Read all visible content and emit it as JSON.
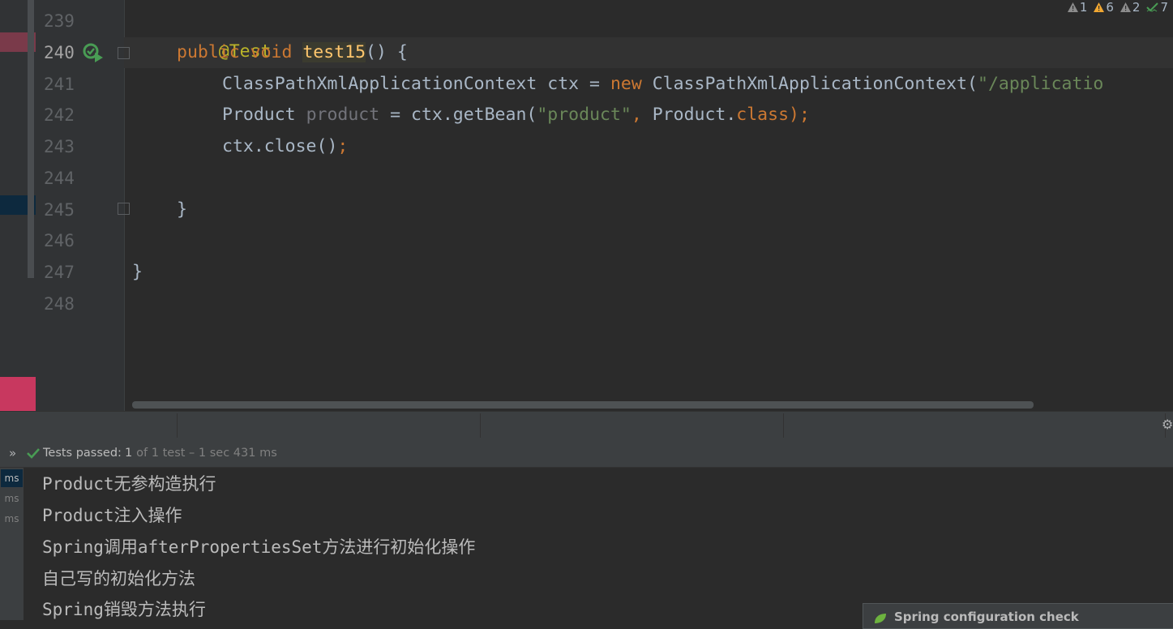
{
  "editor": {
    "inspections": [
      {
        "icon": "warning-gray-icon",
        "count": "1"
      },
      {
        "icon": "warning-yellow-icon",
        "count": "6"
      },
      {
        "icon": "warning-gray-icon",
        "count": "2"
      },
      {
        "icon": "typo-check-icon",
        "count": "7"
      }
    ],
    "line_numbers": [
      "239",
      "240",
      "241",
      "242",
      "243",
      "244",
      "245",
      "246",
      "247",
      "248"
    ],
    "code": {
      "l239_annotation": "@Test",
      "l240_public": "public",
      "l240_void": "void",
      "l240_method": "test15",
      "l240_rest": "() {",
      "l241_type": "ClassPathXmlApplicationContext ctx = ",
      "l241_new": "new",
      "l241_ctor": " ClassPathXmlApplicationContext(",
      "l241_str": "\"/applicatio",
      "l242_type": "Product ",
      "l242_var": "product",
      "l242_mid": " = ctx.getBean(",
      "l242_str": "\"product\"",
      "l242_comma": ", ",
      "l242_cls": "Product.",
      "l242_class_kw": "class",
      "l242_end": ");",
      "l243_call": "ctx.close()",
      "l243_semi": ";",
      "l245_brace": "}",
      "l247_brace": "}"
    }
  },
  "test_status": {
    "chevron": "»",
    "label": "Tests passed:",
    "count": "1",
    "details": "of 1 test – 1 sec 431 ms"
  },
  "tree": [
    "ms",
    "ms",
    "ms"
  ],
  "console": [
    "Product无参构造执行",
    "Product注入操作",
    "Spring调用afterPropertiesSet方法进行初始化操作",
    "自己写的初始化方法",
    "Spring销毁方法执行"
  ],
  "notification": {
    "title": "Spring configuration check"
  },
  "colors": {
    "editor_bg": "#2b2b2b",
    "keyword": "#cc7832",
    "annotation": "#bbb529",
    "method": "#ffc66d",
    "string": "#6a8759",
    "success": "#499c54",
    "stripe_error": "#c8385f",
    "stripe_selected": "#0d293e"
  }
}
